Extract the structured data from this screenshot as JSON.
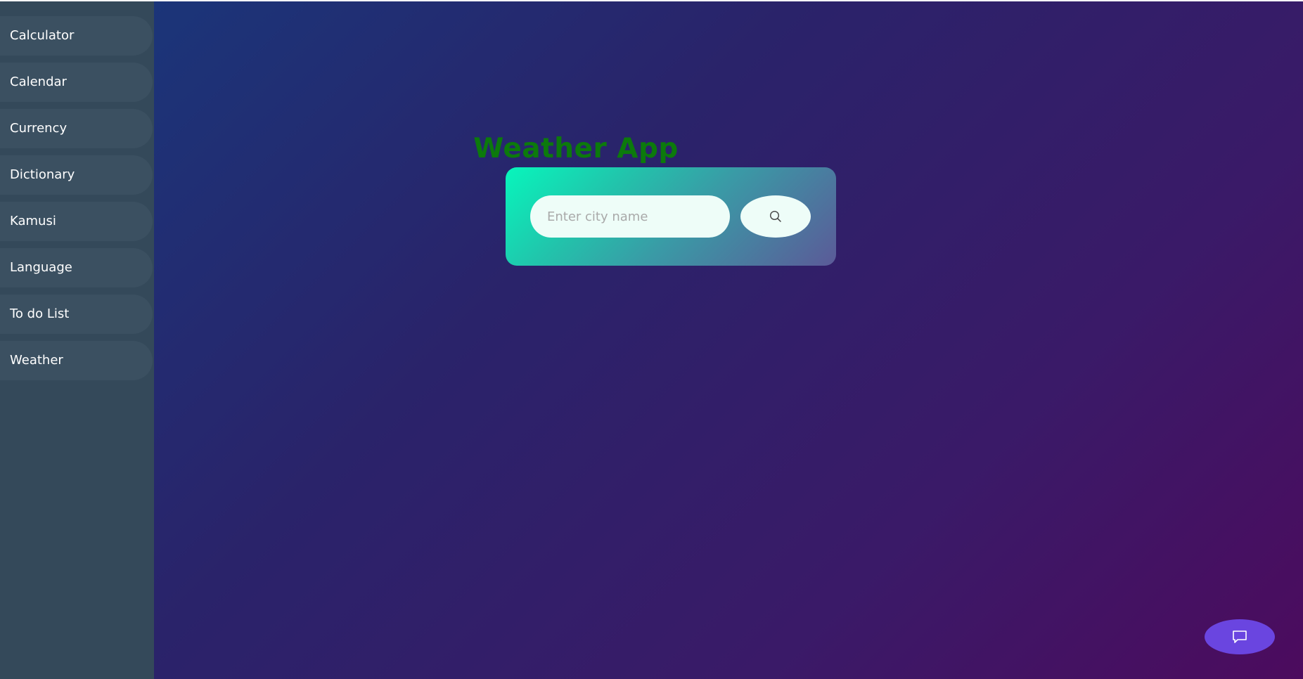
{
  "sidebar": {
    "items": [
      {
        "label": "Calculator"
      },
      {
        "label": "Calendar"
      },
      {
        "label": "Currency"
      },
      {
        "label": "Dictionary"
      },
      {
        "label": "Kamusi"
      },
      {
        "label": "Language"
      },
      {
        "label": "To do List"
      },
      {
        "label": "Weather"
      }
    ]
  },
  "main": {
    "title": "Weather App",
    "search": {
      "placeholder": "Enter city name",
      "value": "",
      "button_icon": "search-icon"
    }
  },
  "chat": {
    "icon": "chat-bubble-icon"
  },
  "colors": {
    "sidebar_bg": "#34495a",
    "title": "#0c7a0c",
    "chat_button": "#6a45e0"
  }
}
